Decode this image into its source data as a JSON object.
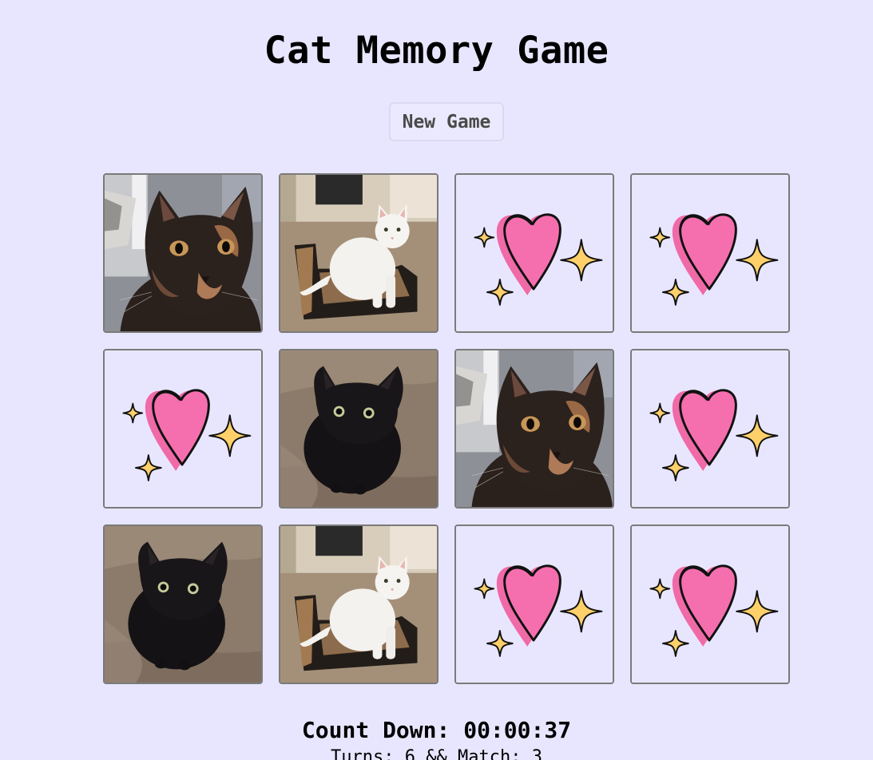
{
  "title": "Cat Memory Game",
  "new_game_label": "New Game",
  "status": {
    "countdown_label": "Count Down:",
    "countdown_value": "00:00:37",
    "turns_text": "Turns: 6 && Match: 3"
  },
  "colors": {
    "background": "#e8e6fe",
    "heart": "#f06aa8",
    "sparkle": "#fdd06a",
    "card_border": "#7a7a7a"
  },
  "cards": [
    {
      "face": "tortoiseshell-cat",
      "state": "revealed"
    },
    {
      "face": "white-cat",
      "state": "revealed"
    },
    {
      "face": "heart-card-back",
      "state": "hidden"
    },
    {
      "face": "heart-card-back",
      "state": "hidden"
    },
    {
      "face": "heart-card-back",
      "state": "hidden"
    },
    {
      "face": "black-cat",
      "state": "revealed"
    },
    {
      "face": "tortoiseshell-cat",
      "state": "revealed"
    },
    {
      "face": "heart-card-back",
      "state": "hidden"
    },
    {
      "face": "black-cat",
      "state": "revealed"
    },
    {
      "face": "white-cat",
      "state": "revealed"
    },
    {
      "face": "heart-card-back",
      "state": "hidden"
    },
    {
      "face": "heart-card-back",
      "state": "hidden"
    }
  ]
}
